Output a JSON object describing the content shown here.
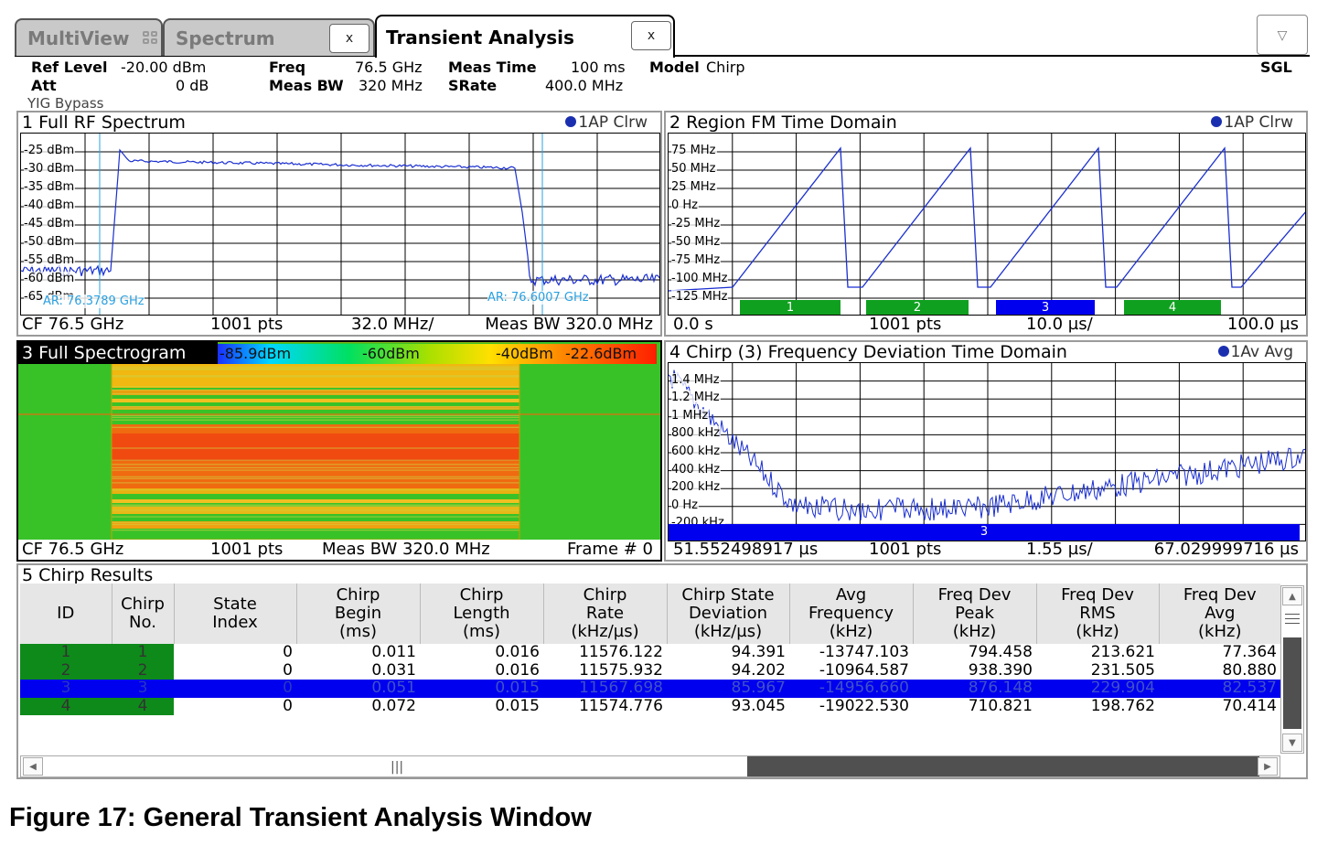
{
  "tabs": [
    {
      "label": "MultiView"
    },
    {
      "label": "Spectrum",
      "close": "x"
    },
    {
      "label": "Transient Analysis",
      "close": "x",
      "active": true
    }
  ],
  "dropdown_icon": "chevron-down-icon",
  "settings": {
    "ref_level_label": "Ref Level",
    "ref_level_value": "-20.00 dBm",
    "att_label": "Att",
    "att_value": "0 dB",
    "yig": "YIG Bypass",
    "freq_label": "Freq",
    "freq_value": "76.5 GHz",
    "meas_bw_label": "Meas BW",
    "meas_bw_value": "320 MHz",
    "meas_time_label": "Meas Time",
    "meas_time_value": "100 ms",
    "srate_label": "SRate",
    "srate_value": "400.0 MHz",
    "model_label": "Model",
    "model_value": "Chirp",
    "sweep_mode": "SGL"
  },
  "panel1": {
    "title": "1 Full RF Spectrum",
    "trace": "1AP Clrw",
    "yticks": [
      "-25 dBm",
      "-30 dBm",
      "-35 dBm",
      "-40 dBm",
      "-45 dBm",
      "-50 dBm",
      "-55 dBm",
      "-60 dBm",
      "-65 dBm"
    ],
    "marker_left": "AR: 76.3789 GHz",
    "marker_right": "AR: 76.6007 GHz",
    "foot": {
      "a": "CF 76.5 GHz",
      "b": "1001 pts",
      "c": "32.0 MHz/",
      "d": "Meas BW 320.0 MHz"
    }
  },
  "panel2": {
    "title": "2 Region FM Time Domain",
    "trace": "1AP Clrw",
    "yticks": [
      "75 MHz",
      "50 MHz",
      "25 MHz",
      "0 Hz",
      "-25 MHz",
      "-50 MHz",
      "-75 MHz",
      "-100 MHz",
      "-125 MHz"
    ],
    "chirp_labels": [
      "1",
      "2",
      "3",
      "4"
    ],
    "foot": {
      "a": "0.0 s",
      "b": "1001 pts",
      "c": "10.0 µs/",
      "d": "100.0 µs"
    }
  },
  "panel3": {
    "title": "3 Full Spectrogram",
    "scale": [
      "-85.9dBm",
      "-60dBm",
      "-40dBm",
      "-22.6dBm"
    ],
    "foot": {
      "a": "CF 76.5 GHz",
      "b": "1001 pts",
      "c": "Meas BW 320.0 MHz",
      "d": "Frame # 0"
    }
  },
  "panel4": {
    "title": "4 Chirp (3) Frequency Deviation Time Domain",
    "trace": "1Av Avg",
    "yticks": [
      "1.4 MHz",
      "1.2 MHz",
      "1 MHz",
      "800 kHz",
      "600 kHz",
      "400 kHz",
      "200 kHz",
      "0 Hz",
      "-200 kHz"
    ],
    "chirp_label": "3",
    "foot": {
      "a": "51.552498917 µs",
      "b": "1001 pts",
      "c": "1.55 µs/",
      "d": "67.029999716 µs"
    }
  },
  "panel5": {
    "title": "5 Chirp Results",
    "columns": [
      [
        "ID"
      ],
      [
        "Chirp",
        "No."
      ],
      [
        "State",
        "Index"
      ],
      [
        "Chirp",
        "Begin",
        "(ms)"
      ],
      [
        "Chirp",
        "Length",
        "(ms)"
      ],
      [
        "Chirp",
        "Rate",
        "(kHz/µs)"
      ],
      [
        "Chirp State",
        "Deviation",
        "(kHz/µs)"
      ],
      [
        "Avg",
        "Frequency",
        "(kHz)"
      ],
      [
        "Freq Dev",
        "Peak",
        "(kHz)"
      ],
      [
        "Freq Dev",
        "RMS",
        "(kHz)"
      ],
      [
        "Freq Dev",
        "Avg",
        "(kHz)"
      ]
    ],
    "rows": [
      [
        "1",
        "1",
        "0",
        "0.011",
        "0.016",
        "11576.122",
        "94.391",
        "-13747.103",
        "794.458",
        "213.621",
        "77.364"
      ],
      [
        "2",
        "2",
        "0",
        "0.031",
        "0.016",
        "11575.932",
        "94.202",
        "-10964.587",
        "938.390",
        "231.505",
        "80.880"
      ],
      [
        "3",
        "3",
        "0",
        "0.051",
        "0.015",
        "11567.698",
        "85.967",
        "-14956.660",
        "876.148",
        "229.904",
        "82.537"
      ],
      [
        "4",
        "4",
        "0",
        "0.072",
        "0.015",
        "11574.776",
        "93.045",
        "-19022.530",
        "710.821",
        "198.762",
        "70.414"
      ]
    ],
    "selected_row": 2
  },
  "caption": "Figure 17: General Transient Analysis Window",
  "colors": {
    "trace": "#1a2fd0",
    "marker": "#2aa0e0",
    "chirp_green": "#10a020",
    "chirp_blue": "#0000ee",
    "selected_row": "#0000ee"
  }
}
